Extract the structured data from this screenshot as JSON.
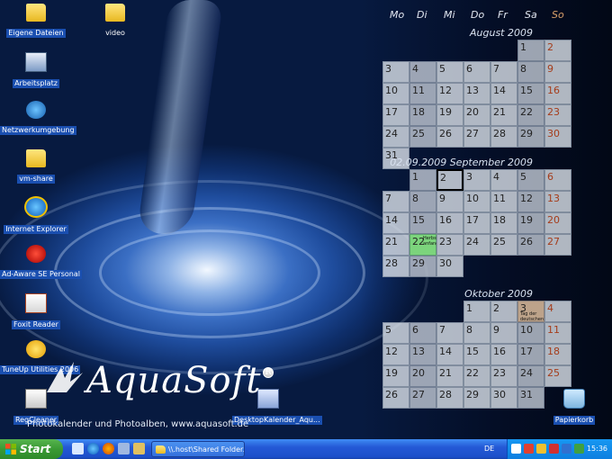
{
  "desktop_icons": [
    {
      "label": "Eigene Dateien",
      "icon": "folder-icon",
      "kind": "folder",
      "selected": true
    },
    {
      "label": "Arbeitsplatz",
      "icon": "computer-icon",
      "kind": "pc",
      "selected": true
    },
    {
      "label": "Netzwerkumgebung",
      "icon": "network-icon",
      "kind": "net",
      "selected": true
    },
    {
      "label": "vm-share",
      "icon": "folder-icon",
      "kind": "folder",
      "selected": true
    },
    {
      "label": "Internet Explorer",
      "icon": "internet-explorer-icon",
      "kind": "ie",
      "selected": true
    },
    {
      "label": "Ad-Aware SE Personal",
      "icon": "ad-aware-icon",
      "kind": "adaware",
      "selected": true
    },
    {
      "label": "Foxit Reader",
      "icon": "foxit-reader-icon",
      "kind": "foxit",
      "selected": true
    },
    {
      "label": "TuneUp Utilities 2006",
      "icon": "tuneup-icon",
      "kind": "tuneup",
      "selected": true
    },
    {
      "label": "RegCleaner",
      "icon": "regcleaner-icon",
      "kind": "reg",
      "selected": true
    },
    {
      "label": "video",
      "icon": "folder-icon",
      "kind": "folder",
      "selected": false
    },
    {
      "label": "DesktopKalender_Aqu...",
      "icon": "desktop-calendar-icon",
      "kind": "deskcal",
      "selected": true
    },
    {
      "label": "Papierkorb",
      "icon": "recycle-bin-icon",
      "kind": "bin",
      "selected": true
    }
  ],
  "brand": {
    "name": "AquaSoft",
    "tagline": "Photokalender und Photoalben, www.aquasoft.de"
  },
  "calendar": {
    "weekdays": [
      "Mo",
      "Di",
      "Mi",
      "Do",
      "Fr",
      "Sa",
      "So"
    ],
    "months": [
      {
        "title": "August 2009",
        "first_weekday": 6,
        "days": 31
      },
      {
        "title": "02.09.2009 September 2009",
        "first_weekday": 2,
        "days": 30,
        "today": 2,
        "events": [
          {
            "day": 22,
            "text": "Herbst-anfang",
            "type": "holiday"
          }
        ]
      },
      {
        "title": "Oktober 2009",
        "first_weekday": 4,
        "days": 31,
        "events": [
          {
            "day": 3,
            "text": "Tag der deutschen Einheit",
            "type": "note"
          }
        ]
      }
    ]
  },
  "taskbar": {
    "start_label": "Start",
    "task_label": "\\\\.host\\Shared Folder...",
    "language": "DE",
    "clock": "15:36"
  },
  "colors": {
    "taskbar_blue": "#245edb",
    "start_green": "#3a9a34",
    "holiday_green": "#7cd47c",
    "sunday_text": "#a53c1a"
  }
}
